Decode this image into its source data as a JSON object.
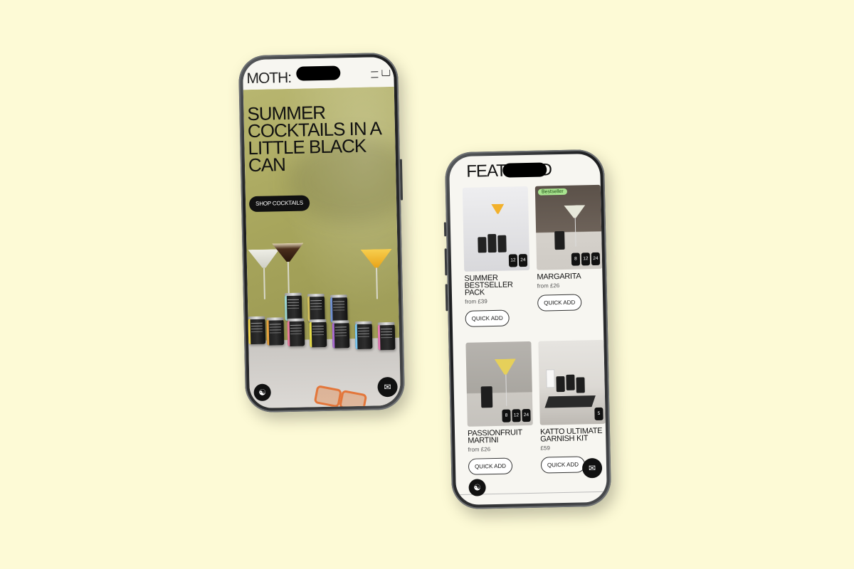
{
  "background_color": "#fdfad6",
  "phone1": {
    "logo": "MOTH:",
    "menu_icon": "hamburger-menu-icon",
    "cart_icon": "cart-icon",
    "hero_title": "SUMMER COCKTAILS IN A LITTLE BLACK CAN",
    "cta_label": "SHOP COCKTAILS",
    "accessibility_icon": "accessibility-icon",
    "chat_icon": "chat-icon"
  },
  "phone2": {
    "section_title": "FEATURED",
    "products": [
      {
        "name": "SUMMER BESTSELLER PACK",
        "price": "from £39",
        "quick_add": "QUICK ADD",
        "badge": "",
        "sizes": [
          "12",
          "24"
        ]
      },
      {
        "name": "MARGARITA",
        "price": "from £26",
        "quick_add": "QUICK ADD",
        "badge": "Bestseller",
        "sizes": [
          "8",
          "12",
          "24"
        ]
      },
      {
        "name": "PASSIONFRUIT MARTINI",
        "price": "from £26",
        "quick_add": "QUICK ADD",
        "badge": "",
        "sizes": [
          "8",
          "12",
          "24"
        ]
      },
      {
        "name": "KATTO ULTIMATE GARNISH KIT",
        "price": "£59",
        "quick_add": "QUICK ADD",
        "badge": "",
        "sizes": [
          "5"
        ]
      }
    ],
    "accessibility_icon": "accessibility-icon",
    "chat_icon": "chat-icon"
  }
}
